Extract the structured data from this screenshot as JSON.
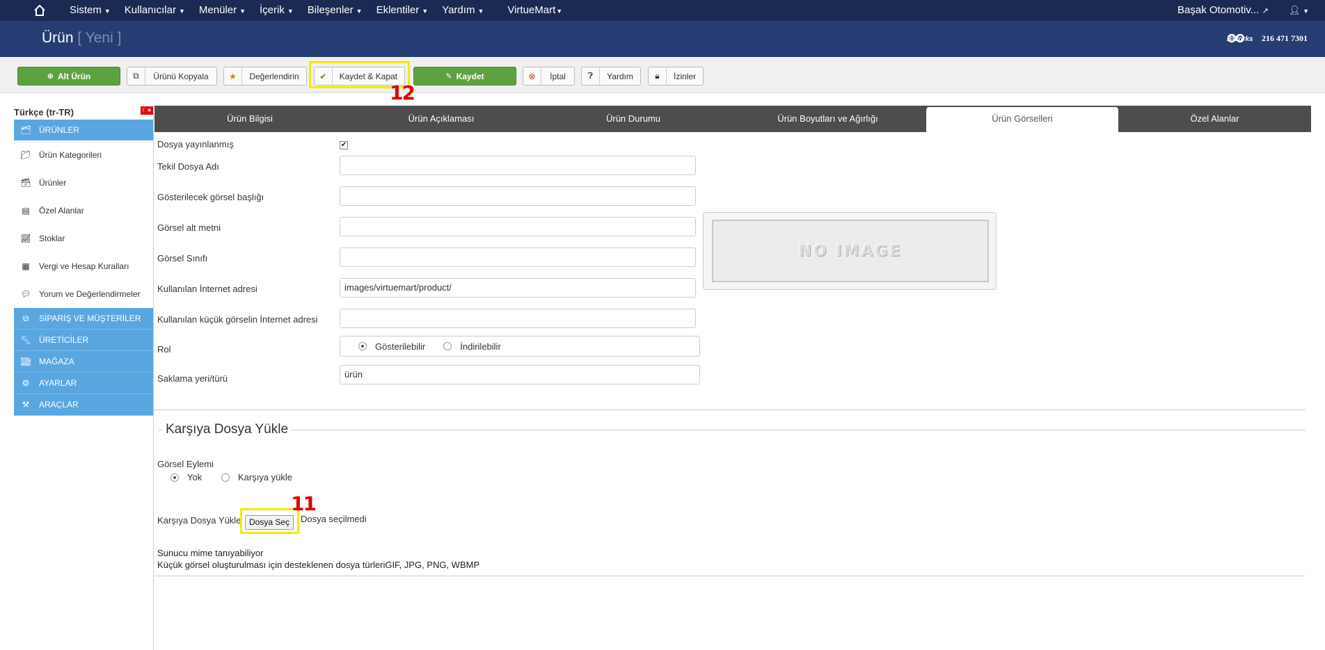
{
  "nav": {
    "home_icon": "home-icon",
    "items": [
      {
        "label": "Sistem"
      },
      {
        "label": "Kullanıcılar"
      },
      {
        "label": "Menüler"
      },
      {
        "label": "İçerik"
      },
      {
        "label": "Bileşenler"
      },
      {
        "label": "Eklentiler"
      },
      {
        "label": "Yardım"
      },
      {
        "label": "VirtueMart"
      }
    ],
    "site_name": "Başak Otomotiv...",
    "user_icon": "user-icon"
  },
  "header": {
    "title": "Ürün",
    "subtitle": "[ Yeni ]",
    "logo_text": "BWorks",
    "phone": "216 471 7301"
  },
  "toolbar": {
    "alt_urun": "Alt Ürün",
    "kopyala": "Ürünü Kopyala",
    "degerlendir": "Değerlendirin",
    "kaydet_kapat": "Kaydet & Kapat",
    "kaydet": "Kaydet",
    "iptal": "İptal",
    "yardim": "Yardım",
    "izinler": "İzinler"
  },
  "markers": {
    "m12": "12",
    "m11": "11"
  },
  "sidebar": {
    "language": "Türkçe (tr-TR)",
    "flag": "☾★",
    "head": "ÜRÜNLER",
    "items": [
      {
        "label": "Ürün Kategorileri",
        "icon": "folder-icon"
      },
      {
        "label": "Ürünler",
        "icon": "products-icon"
      },
      {
        "label": "Özel Alanlar",
        "icon": "custom-fields-icon"
      },
      {
        "label": "Stoklar",
        "icon": "chart-icon"
      },
      {
        "label": "Vergi ve Hesap Kuralları",
        "icon": "calculator-icon"
      },
      {
        "label": "Yorum ve Değerlendirmeler",
        "icon": "comment-icon"
      }
    ],
    "sections": [
      {
        "label": "SİPARİŞ VE MÜŞTERİLER"
      },
      {
        "label": "ÜRETİCİLER"
      },
      {
        "label": "MAĞAZA"
      },
      {
        "label": "AYARLAR"
      },
      {
        "label": "ARAÇLAR"
      }
    ]
  },
  "tabs": [
    {
      "label": "Ürün Bilgisi"
    },
    {
      "label": "Ürün Açıklaması"
    },
    {
      "label": "Ürün Durumu"
    },
    {
      "label": "Ürün Boyutları ve Ağırlığı"
    },
    {
      "label": "Ürün Görselleri"
    },
    {
      "label": "Özel Alanlar"
    }
  ],
  "form": {
    "published_label": "Dosya yayınlanmış",
    "published_checked": true,
    "unique_name_label": "Tekil Dosya Adı",
    "unique_name_value": "",
    "title_label": "Gösterilecek görsel başlığı",
    "title_value": "",
    "alt_label": "Görsel alt metni",
    "alt_value": "",
    "class_label": "Görsel Sınıfı",
    "class_value": "",
    "url_label": "Kullanılan İnternet adresi",
    "url_value": "images/virtuemart/product/",
    "thumb_url_label": "Kullanılan küçük görselin İnternet adresi",
    "thumb_url_value": "",
    "role_label": "Rol",
    "role_options": [
      "Gösterilebilir",
      "İndirilebilir"
    ],
    "role_selected": "Gösterilebilir",
    "storage_label": "Saklama yeri/türü",
    "storage_value": "ürün",
    "no_image_text": "NO IMAGE"
  },
  "upload": {
    "legend": "Karşıya Dosya Yükle",
    "action_label": "Görsel Eylemi",
    "action_options": [
      "Yok",
      "Karşıya yükle"
    ],
    "action_selected": "Yok",
    "file_label": "Karşıya Dosya Yükle",
    "file_button": "Dosya Seç",
    "file_status": "Dosya seçilmedi",
    "mime_note": "Sunucu mime tanıyabiliyor",
    "types_note": "Küçük görsel oluşturulması için desteklenen dosya türleriGIF, JPG, PNG, WBMP"
  },
  "colors": {
    "nav_bg": "#1a2a52",
    "header_bg": "#253d72",
    "accent_green": "#5ea140",
    "sidebar_blue": "#5aa6e0",
    "highlight_yellow": "#f4ea00",
    "marker_red": "#e00000"
  }
}
